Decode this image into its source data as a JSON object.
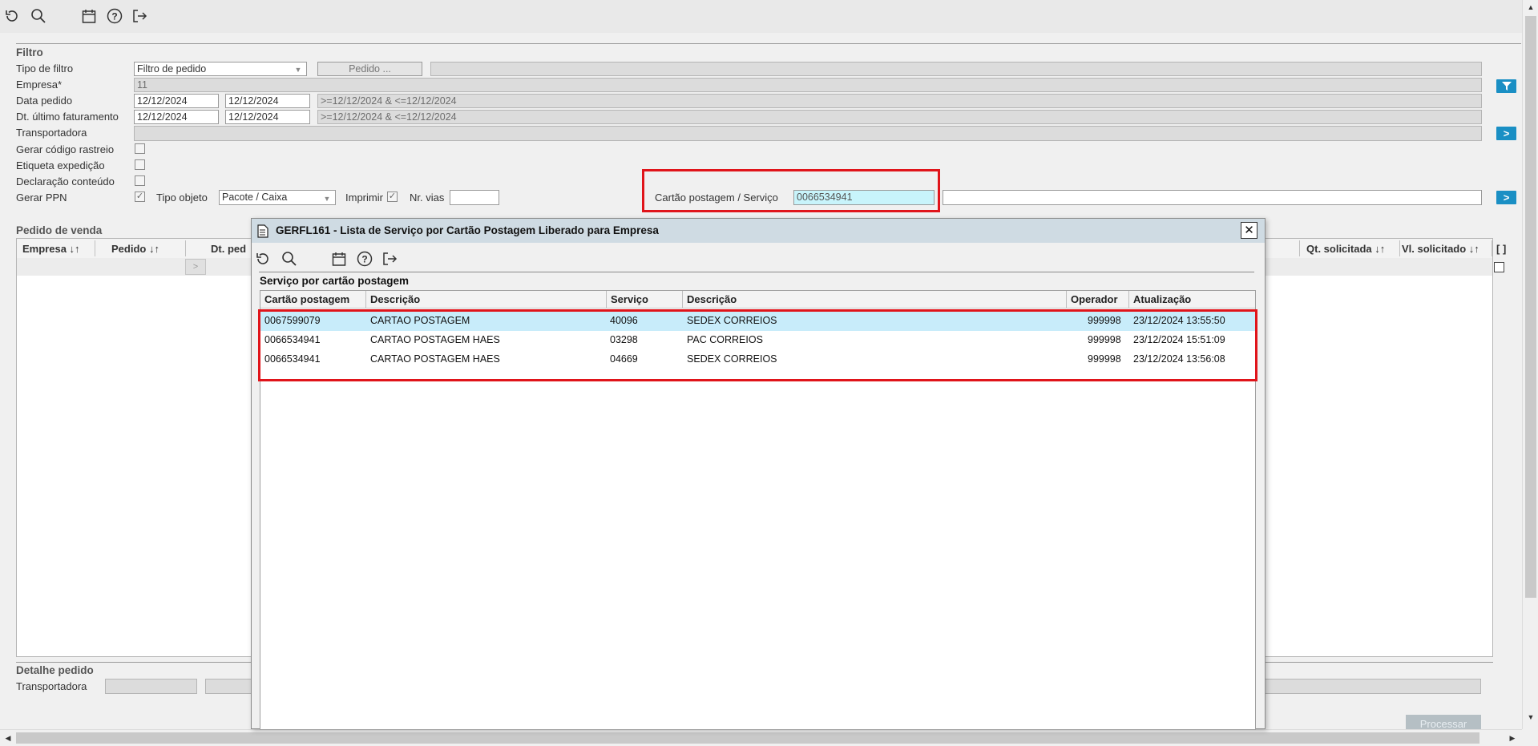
{
  "toolbar": {
    "icons": [
      "refresh-icon",
      "search-icon",
      "calendar-icon",
      "help-icon",
      "exit-icon"
    ]
  },
  "filtro": {
    "title": "Filtro",
    "tipo_filtro": {
      "label": "Tipo de filtro",
      "value": "Filtro de pedido",
      "button": "Pedido ..."
    },
    "empresa": {
      "label": "Empresa*",
      "value": "11"
    },
    "data_pedido": {
      "label": "Data pedido",
      "from": "12/12/2024",
      "to": "12/12/2024",
      "expr": ">=12/12/2024 & <=12/12/2024"
    },
    "dt_ultimo_faturamento": {
      "label": "Dt. último faturamento",
      "from": "12/12/2024",
      "to": "12/12/2024",
      "expr": ">=12/12/2024 & <=12/12/2024"
    },
    "transportadora": {
      "label": "Transportadora"
    },
    "gerar_codigo_rastreio": {
      "label": "Gerar código rastreio"
    },
    "etiqueta_expedicao": {
      "label": "Etiqueta expedição"
    },
    "declaracao_conteudo": {
      "label": "Declaração conteúdo"
    },
    "gerar_ppn": {
      "label": "Gerar PPN",
      "check": "✓"
    },
    "tipo_objeto": {
      "label": "Tipo objeto",
      "value": "Pacote / Caixa"
    },
    "imprimir": {
      "label": "Imprimir",
      "check": "✓"
    },
    "nr_vias": {
      "label": "Nr. vias",
      "value": ""
    },
    "cartao_postagem": {
      "label": "Cartão postagem / Serviço",
      "value": "0066534941"
    }
  },
  "pedido_venda": {
    "title": "Pedido de venda",
    "columns": [
      "Empresa ↓↑",
      "Pedido ↓↑",
      "Dt. ped",
      "Qt. solicitada ↓↑",
      "Vl. solicitado ↓↑",
      "[ ]"
    ],
    "row_arrow": ">"
  },
  "detalhe": {
    "title": "Detalhe pedido",
    "transportadora_label": "Transportadora",
    "processar_button": "Processar"
  },
  "dialog": {
    "title": "GERFL161 - Lista de Serviço por Cartão Postagem Liberado para Empresa",
    "close": "✕",
    "section": "Serviço por cartão postagem",
    "columns": [
      "Cartão postagem",
      "Descrição",
      "Serviço",
      "Descrição",
      "Operador",
      "Atualização"
    ],
    "rows": [
      {
        "cartao": "0067599079",
        "descricao": "CARTAO POSTAGEM",
        "servico": "40096",
        "descricao2": "SEDEX CORREIOS",
        "operador": "999998",
        "atualizacao": "23/12/2024 13:55:50"
      },
      {
        "cartao": "0066534941",
        "descricao": "CARTAO POSTAGEM HAES",
        "servico": "03298",
        "descricao2": "PAC CORREIOS",
        "operador": "999998",
        "atualizacao": "23/12/2024 15:51:09"
      },
      {
        "cartao": "0066534941",
        "descricao": "CARTAO POSTAGEM HAES",
        "servico": "04669",
        "descricao2": "SEDEX CORREIOS",
        "operador": "999998",
        "atualizacao": "23/12/2024 13:56:08"
      }
    ]
  },
  "colors": {
    "accent": "#1a8fc4",
    "highlight": "#e0141a",
    "selected_row": "#c8ecfa",
    "cartao_field": "#c8f4fb"
  }
}
